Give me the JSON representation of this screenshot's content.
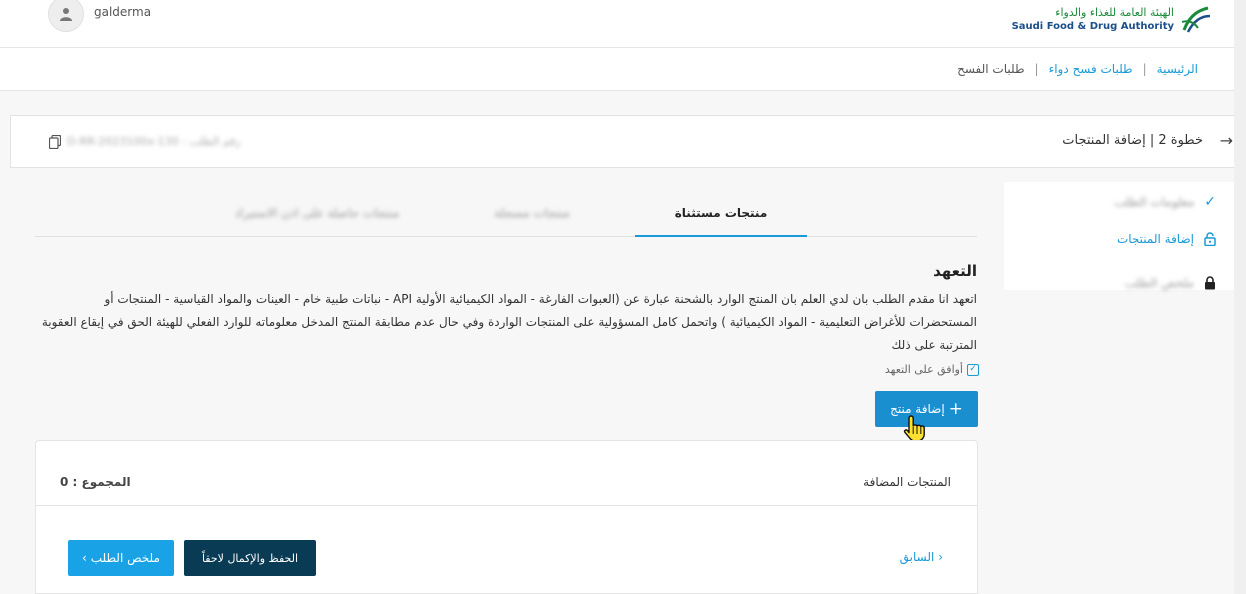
{
  "header": {
    "logo_ar": "الهيئة العامة للغذاء والدواء",
    "logo_en": "Saudi Food & Drug Authority",
    "user_name": "galderma"
  },
  "breadcrumb": {
    "home": "الرئيسية",
    "parent": "طلبات فسح دواء",
    "current": "طلبات الفسح",
    "separator": "|"
  },
  "step": {
    "title": "خطوة 2 | إضافة المنتجات",
    "request_number": "رقم الطلب : D-RR-2023100x-130"
  },
  "sidebar": {
    "items": [
      {
        "label": "معلومات الطلب",
        "icon": "check-icon",
        "state": "done"
      },
      {
        "label": "إضافة المنتجات",
        "icon": "unlock-icon",
        "state": "active"
      },
      {
        "label": "ملخص الطلب",
        "icon": "lock-icon",
        "state": "locked"
      }
    ]
  },
  "tabs": [
    {
      "label": "منتجات مستثناة",
      "active": true
    },
    {
      "label": "منتجات مسجلة",
      "active": false
    },
    {
      "label": "منتجات حاصلة على اذن الاستيراد",
      "active": false
    }
  ],
  "pledge": {
    "title": "التعهد",
    "text": "اتعهد انا مقدم الطلب بان لدي العلم بان المنتج الوارد بالشحنة عبارة عن (العبوات الفارغة - المواد الكيميائية الأولية API - نباتات طبية خام - العينات والمواد القياسية - المنتجات أو المستحضرات للأغراض التعليمية - المواد الكيميائية ) واتحمل كامل المسؤولية على المنتجات الواردة وفي حال عدم مطابقة المنتج المدخل معلوماته للوارد الفعلي للهيئة الحق في إيقاع العقوبة المترتبة على ذلك",
    "agree_label": "أوافق على التعهد",
    "agreed": true
  },
  "add_product_button": "إضافة منتج",
  "products": {
    "title": "المنتجات المضافة",
    "total": "المجموع : 0"
  },
  "footer": {
    "previous": "السابق",
    "save_later": "الحفظ والإكمال لاحقاً",
    "summary": "ملخص الطلب"
  },
  "colors": {
    "accent": "#1a9ad6",
    "primary_button": "#1a8fd0",
    "dark_button": "#0a3b55"
  }
}
